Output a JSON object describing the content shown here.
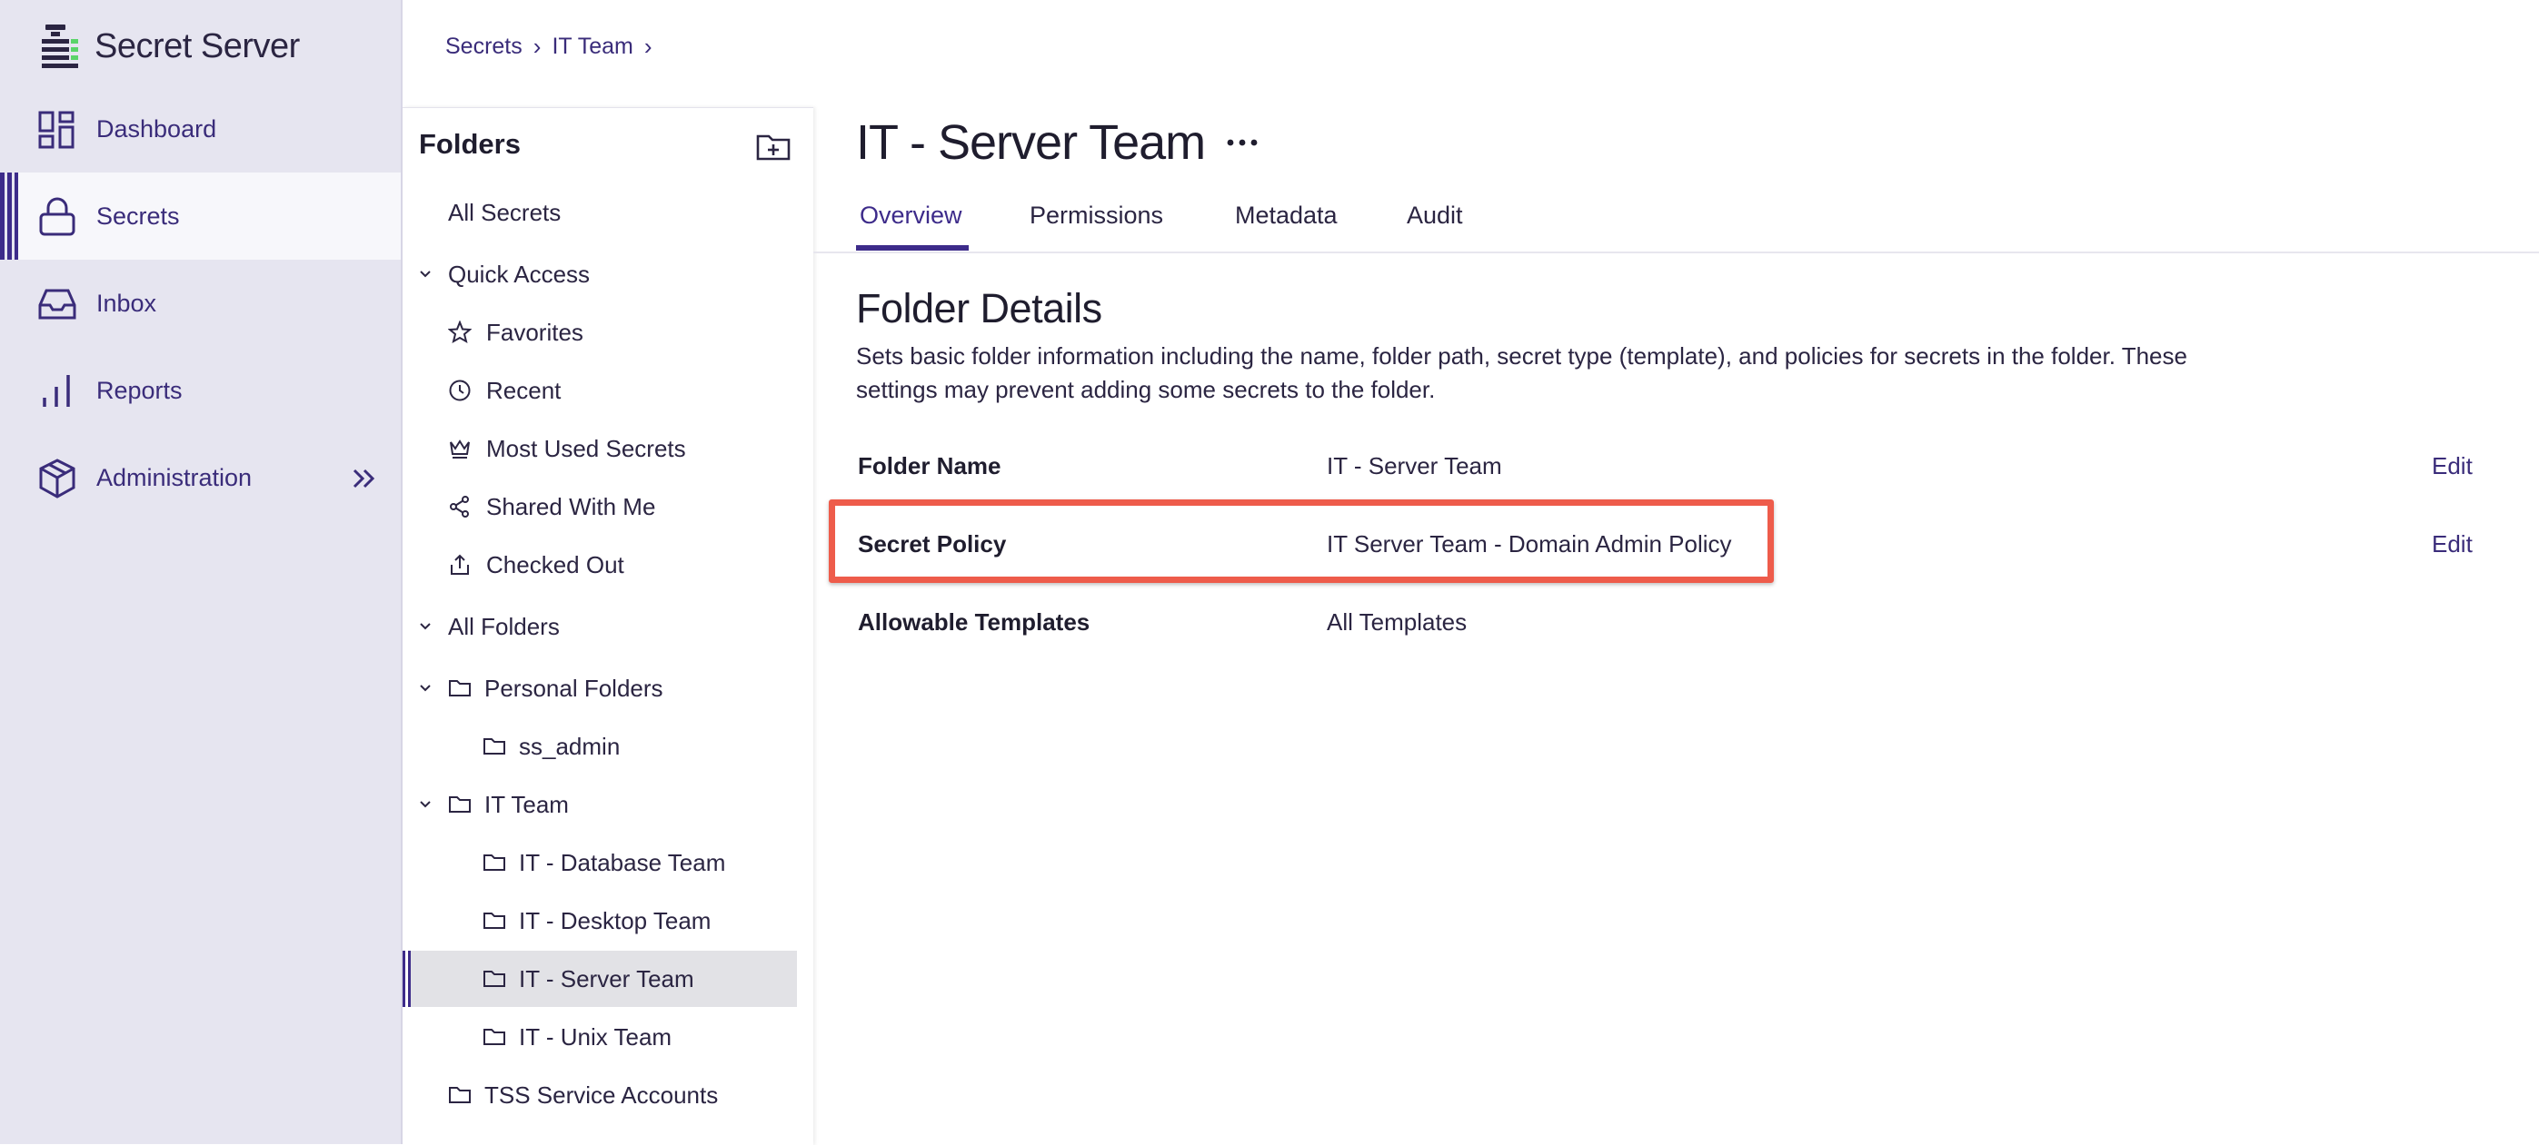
{
  "app": {
    "title": "Secret Server"
  },
  "nav": {
    "items": [
      {
        "label": "Dashboard",
        "icon": "dashboard-icon"
      },
      {
        "label": "Secrets",
        "icon": "lock-icon",
        "active": true
      },
      {
        "label": "Inbox",
        "icon": "inbox-icon"
      },
      {
        "label": "Reports",
        "icon": "bar-chart-icon"
      },
      {
        "label": "Administration",
        "icon": "cube-icon",
        "expand_icon": "double-chevron-right-icon"
      }
    ]
  },
  "breadcrumb": [
    "Secrets",
    "IT Team"
  ],
  "tree": {
    "title": "Folders",
    "items": [
      {
        "label": "All Secrets"
      },
      {
        "label": "Quick Access",
        "expanded": true
      },
      {
        "label": "Favorites",
        "icon": "star-icon"
      },
      {
        "label": "Recent",
        "icon": "clock-icon"
      },
      {
        "label": "Most Used Secrets",
        "icon": "crown-icon"
      },
      {
        "label": "Shared With Me",
        "icon": "share-icon"
      },
      {
        "label": "Checked Out",
        "icon": "upload-icon"
      },
      {
        "label": "All Folders",
        "expanded": true
      },
      {
        "label": "Personal Folders",
        "icon": "folder-icon",
        "expanded": true
      },
      {
        "label": "ss_admin",
        "icon": "folder-icon"
      },
      {
        "label": "IT Team",
        "icon": "folder-icon",
        "expanded": true
      },
      {
        "label": "IT - Database Team",
        "icon": "folder-icon"
      },
      {
        "label": "IT - Desktop Team",
        "icon": "folder-icon"
      },
      {
        "label": "IT - Server Team",
        "icon": "folder-icon",
        "selected": true
      },
      {
        "label": "IT - Unix Team",
        "icon": "folder-icon"
      },
      {
        "label": "TSS Service Accounts",
        "icon": "folder-icon"
      }
    ]
  },
  "main": {
    "title": "IT - Server Team",
    "tabs": [
      {
        "label": "Overview",
        "active": true
      },
      {
        "label": "Permissions"
      },
      {
        "label": "Metadata"
      },
      {
        "label": "Audit"
      }
    ],
    "section": {
      "title": "Folder Details",
      "description": "Sets basic folder information including the name, folder path, secret type (template), and policies for secrets in the folder. These settings may prevent adding some secrets to the folder."
    },
    "details": [
      {
        "label": "Folder Name",
        "value": "IT - Server Team",
        "edit": "Edit"
      },
      {
        "label": "Secret Policy",
        "value": "IT Server Team - Domain Admin Policy",
        "edit": "Edit",
        "highlighted": true
      },
      {
        "label": "Allowable Templates",
        "value": "All Templates"
      }
    ]
  },
  "colors": {
    "accent": "#3d2b8a",
    "nav_background": "#e6e5f0",
    "highlight_border": "#ee5c4b",
    "selected_row": "#e2e2e6",
    "logo_green": "#5ad469"
  }
}
